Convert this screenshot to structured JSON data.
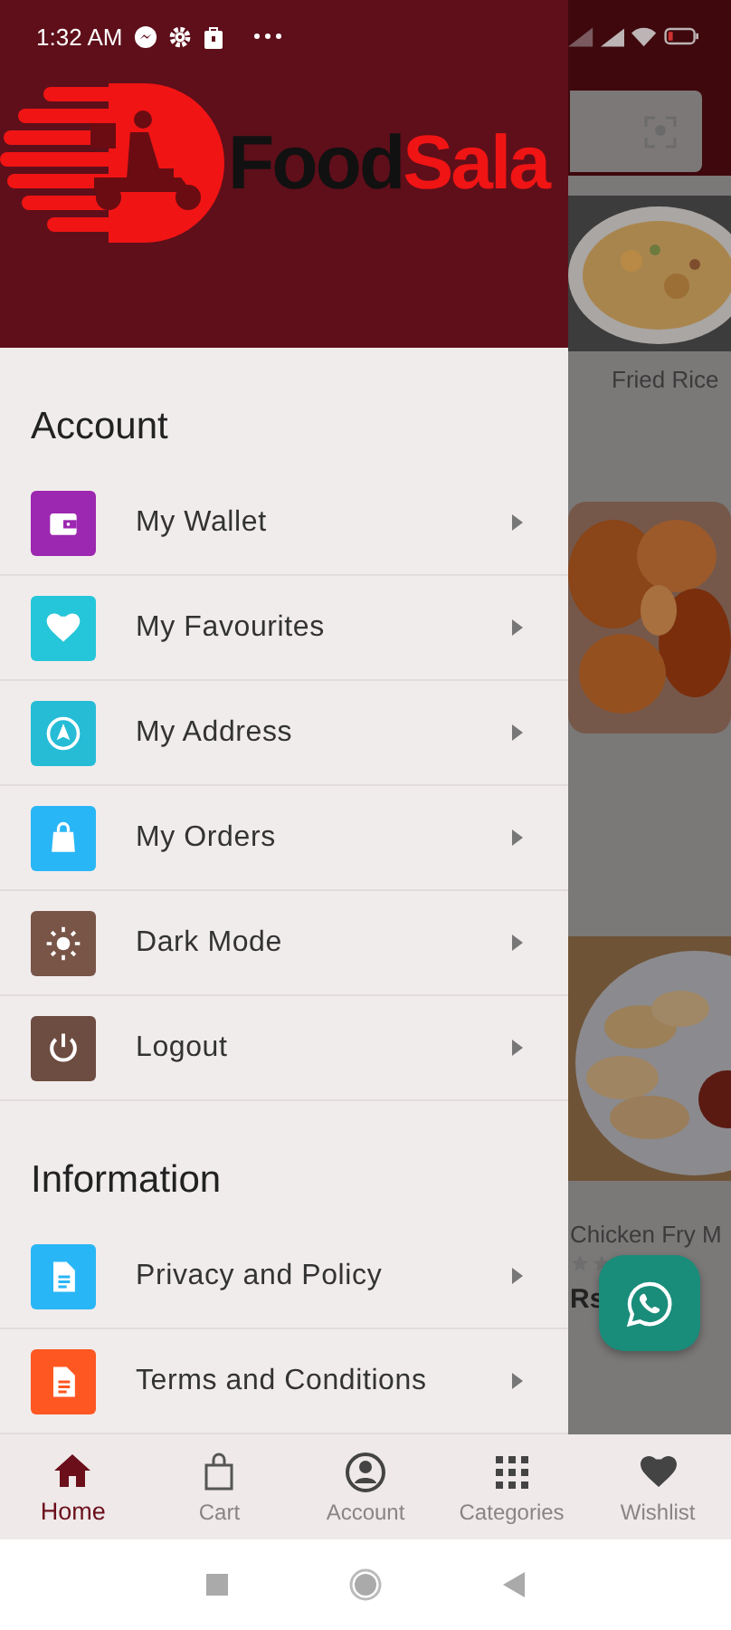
{
  "status_bar": {
    "time": "1:32 AM"
  },
  "logo": {
    "part_1": "Food",
    "part_2": "Sala"
  },
  "drawer": {
    "sections": [
      {
        "title": "Account",
        "items": [
          {
            "label": "My Wallet",
            "kind": "wallet",
            "color": "#9c27b0"
          },
          {
            "label": "My Favourites",
            "kind": "heart",
            "color": "#26c6da"
          },
          {
            "label": "My Address",
            "kind": "navigation",
            "color": "#26bcd6"
          },
          {
            "label": "My Orders",
            "kind": "bag",
            "color": "#29b6f6"
          },
          {
            "label": "Dark Mode",
            "kind": "sun",
            "color": "#795548"
          },
          {
            "label": "Logout",
            "kind": "power",
            "color": "#6d4c41"
          }
        ]
      },
      {
        "title": "Information",
        "items": [
          {
            "label": "Privacy and Policy",
            "kind": "document",
            "color": "#29b6f6"
          },
          {
            "label": "Terms and Conditions",
            "kind": "document",
            "color": "#ff5722"
          }
        ]
      }
    ]
  },
  "background_screen": {
    "product_label": "Fried Rice",
    "product_name": "Chicken Fry M",
    "price": "Rs"
  },
  "bottom_nav": [
    {
      "label": "Home",
      "kind": "home",
      "selected": true
    },
    {
      "label": "Cart",
      "kind": "bag",
      "selected": false
    },
    {
      "label": "Account",
      "kind": "person",
      "selected": false
    },
    {
      "label": "Categories",
      "kind": "grid",
      "selected": false
    },
    {
      "label": "Wishlist",
      "kind": "heart",
      "selected": false
    }
  ]
}
